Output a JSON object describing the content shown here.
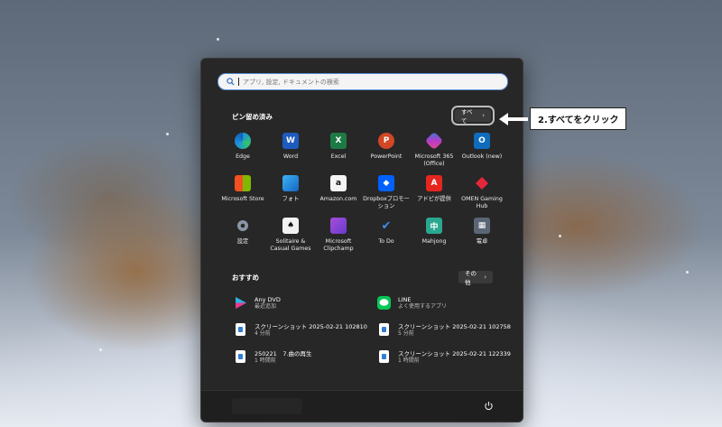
{
  "search": {
    "placeholder": "アプリ, 設定, ドキュメントの検索"
  },
  "pinned": {
    "title": "ピン留め済み",
    "all_label": "すべて",
    "apps": [
      {
        "label": "Edge",
        "icon": "edge-icon"
      },
      {
        "label": "Word",
        "icon": "word-icon"
      },
      {
        "label": "Excel",
        "icon": "excel-icon"
      },
      {
        "label": "PowerPoint",
        "icon": "powerpoint-icon"
      },
      {
        "label": "Microsoft 365\n(Office)",
        "icon": "microsoft-365-icon"
      },
      {
        "label": "Outlook (new)",
        "icon": "outlook-icon"
      },
      {
        "label": "Microsoft Store",
        "icon": "store-icon"
      },
      {
        "label": "フォト",
        "icon": "photos-icon"
      },
      {
        "label": "Amazon.com",
        "icon": "amazon-icon"
      },
      {
        "label": "Dropboxプロモー\nション",
        "icon": "dropbox-icon"
      },
      {
        "label": "アドビが提供",
        "icon": "adobe-icon"
      },
      {
        "label": "OMEN Gaming\nHub",
        "icon": "omen-icon"
      },
      {
        "label": "設定",
        "icon": "settings-gear-icon"
      },
      {
        "label": "Solitaire &\nCasual Games",
        "icon": "solitaire-icon"
      },
      {
        "label": "Microsoft\nClipchamp",
        "icon": "clipchamp-icon"
      },
      {
        "label": "To Do",
        "icon": "todo-check-icon"
      },
      {
        "label": "Mahjong",
        "icon": "mahjong-icon"
      },
      {
        "label": "電卓",
        "icon": "calculator-icon"
      }
    ]
  },
  "recommended": {
    "title": "おすすめ",
    "more_label": "その他",
    "items": [
      {
        "name": "Any DVD",
        "sub": "最近追加",
        "icon": "anydvd-play-icon"
      },
      {
        "name": "LINE",
        "sub": "よく使用するアプリ",
        "icon": "line-app-icon"
      },
      {
        "name": "スクリーンショット 2025-02-21 102810",
        "sub": "4 分前",
        "icon": "image-file-icon"
      },
      {
        "name": "スクリーンショット 2025-02-21 102758",
        "sub": "5 分前",
        "icon": "image-file-icon"
      },
      {
        "name": "250221　7.曲の再生",
        "sub": "1 時間前",
        "icon": "image-file-icon"
      },
      {
        "name": "スクリーンショット 2025-02-21 122339",
        "sub": "1 時間前",
        "icon": "image-file-icon"
      }
    ]
  },
  "annotation": {
    "text": "2.すべてをクリック"
  },
  "colors": {
    "panel": "#272727",
    "accent": "#5a8ed6",
    "annotation_bg": "#ffffff"
  }
}
